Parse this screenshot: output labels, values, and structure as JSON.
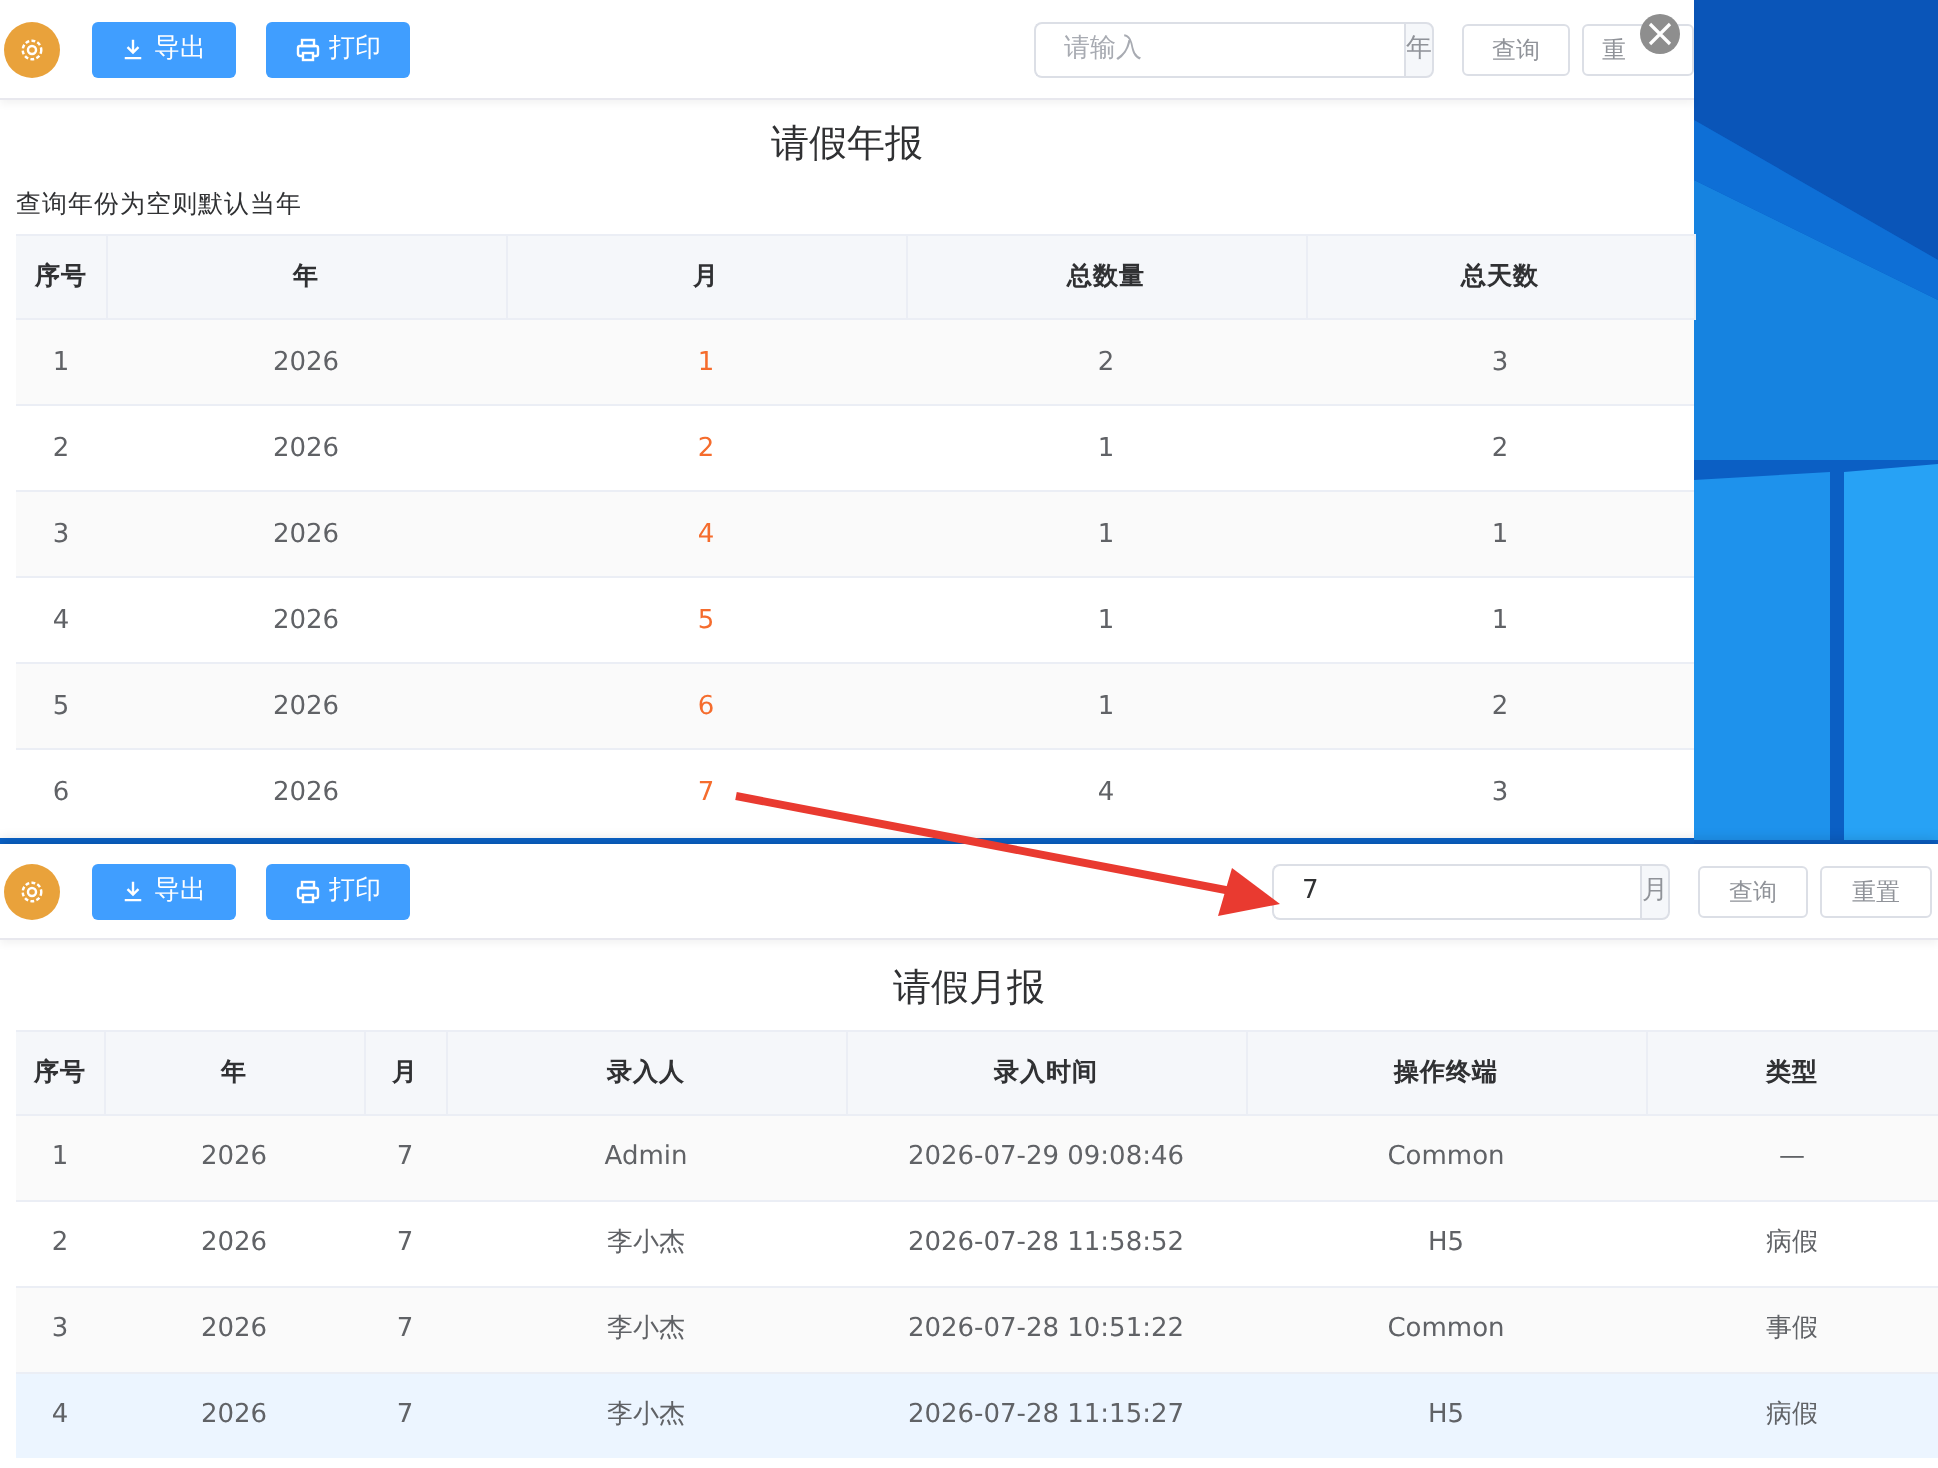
{
  "year_report": {
    "toolbar": {
      "buttons": [
        {
          "label": "导出",
          "kind": "export"
        },
        {
          "label": "打印",
          "kind": "print"
        }
      ],
      "search": {
        "placeholder": "请输入",
        "suffix": "年"
      },
      "actions": [
        "查询",
        "重"
      ]
    },
    "title": "请假年报",
    "note": "查询年份为空则默认当年",
    "table": {
      "columns": [
        {
          "label": "序号",
          "link": false
        },
        {
          "label": "年",
          "link": false
        },
        {
          "label": "月",
          "link": true
        },
        {
          "label": "总数量",
          "link": false
        },
        {
          "label": "总天数",
          "link": false
        }
      ],
      "rows": [
        {
          "cells": [
            "1",
            "2026",
            "1",
            "2",
            "3"
          ]
        },
        {
          "cells": [
            "2",
            "2026",
            "2",
            "1",
            "2"
          ]
        },
        {
          "cells": [
            "3",
            "2026",
            "4",
            "1",
            "1"
          ]
        },
        {
          "cells": [
            "4",
            "2026",
            "5",
            "1",
            "1"
          ]
        },
        {
          "cells": [
            "5",
            "2026",
            "6",
            "1",
            "2"
          ]
        },
        {
          "cells": [
            "6",
            "2026",
            "7",
            "4",
            "3"
          ]
        }
      ]
    }
  },
  "month_report": {
    "toolbar": {
      "buttons": [
        {
          "label": "导出",
          "kind": "export"
        },
        {
          "label": "打印",
          "kind": "print"
        }
      ],
      "search": {
        "value": "7",
        "suffix": "月"
      },
      "actions": [
        "查询",
        "重置"
      ]
    },
    "title": "请假月报",
    "table": {
      "columns": [
        {
          "label": "序号",
          "link": false
        },
        {
          "label": "年",
          "link": false
        },
        {
          "label": "月",
          "link": false
        },
        {
          "label": "录入人",
          "link": false
        },
        {
          "label": "录入时间",
          "link": false
        },
        {
          "label": "操作终端",
          "link": false
        },
        {
          "label": "类型",
          "link": false
        }
      ],
      "rows": [
        {
          "selected": false,
          "cells": [
            "1",
            "2026",
            "7",
            "Admin",
            "2026-07-29 09:08:46",
            "Common",
            "—"
          ]
        },
        {
          "selected": false,
          "cells": [
            "2",
            "2026",
            "7",
            "李小杰",
            "2026-07-28 11:58:52",
            "H5",
            "病假"
          ]
        },
        {
          "selected": false,
          "cells": [
            "3",
            "2026",
            "7",
            "李小杰",
            "2026-07-28 10:51:22",
            "Common",
            "事假"
          ]
        },
        {
          "selected": true,
          "cells": [
            "4",
            "2026",
            "7",
            "李小杰",
            "2026-07-28 11:15:27",
            "H5",
            "病假"
          ]
        }
      ]
    }
  }
}
